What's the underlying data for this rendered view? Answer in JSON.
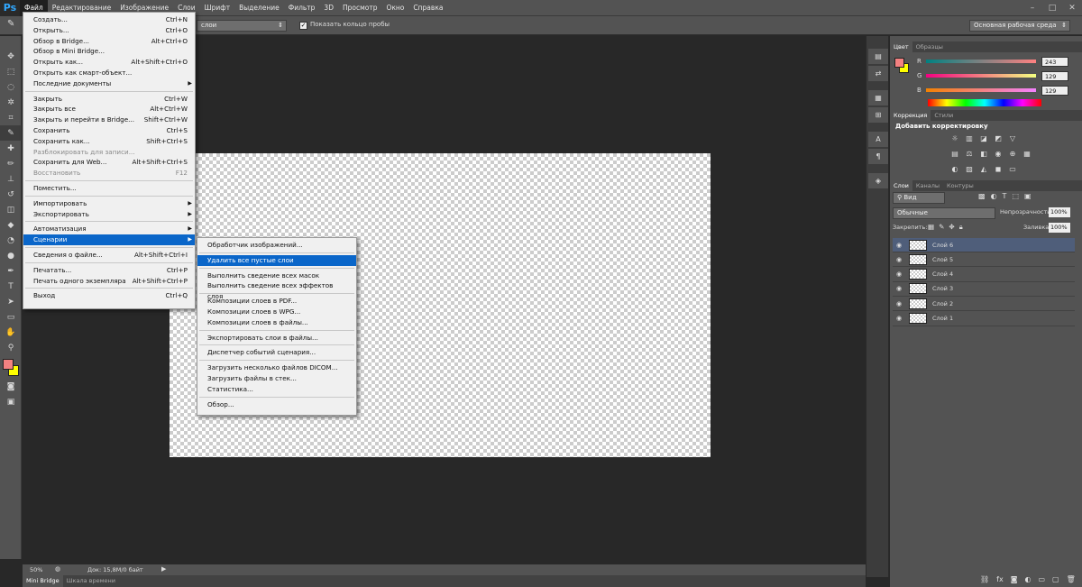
{
  "app": {
    "logo": "Ps"
  },
  "menubar": [
    "Файл",
    "Редактирование",
    "Изображение",
    "Слои",
    "Шрифт",
    "Выделение",
    "Фильтр",
    "3D",
    "Просмотр",
    "Окно",
    "Справка"
  ],
  "options_bar": {
    "mode_value": "слои",
    "sample_ring_label": "Показать кольцо пробы",
    "workspace": "Основная рабочая среда"
  },
  "file_menu": [
    {
      "label": "Создать...",
      "shortcut": "Ctrl+N"
    },
    {
      "label": "Открыть...",
      "shortcut": "Ctrl+O"
    },
    {
      "label": "Обзор в Bridge...",
      "shortcut": "Alt+Ctrl+O"
    },
    {
      "label": "Обзор в Mini Bridge...",
      "shortcut": ""
    },
    {
      "label": "Открыть как...",
      "shortcut": "Alt+Shift+Ctrl+O"
    },
    {
      "label": "Открыть как смарт-объект...",
      "shortcut": ""
    },
    {
      "label": "Последние документы",
      "shortcut": "",
      "submenu": true
    },
    {
      "sep": true
    },
    {
      "label": "Закрыть",
      "shortcut": "Ctrl+W"
    },
    {
      "label": "Закрыть все",
      "shortcut": "Alt+Ctrl+W"
    },
    {
      "label": "Закрыть и перейти в Bridge...",
      "shortcut": "Shift+Ctrl+W"
    },
    {
      "label": "Сохранить",
      "shortcut": "Ctrl+S"
    },
    {
      "label": "Сохранить как...",
      "shortcut": "Shift+Ctrl+S"
    },
    {
      "label": "Разблокировать для записи...",
      "shortcut": "",
      "disabled": true
    },
    {
      "label": "Сохранить для Web...",
      "shortcut": "Alt+Shift+Ctrl+S"
    },
    {
      "label": "Восстановить",
      "shortcut": "F12",
      "disabled": true
    },
    {
      "sep": true
    },
    {
      "label": "Поместить...",
      "shortcut": ""
    },
    {
      "sep": true
    },
    {
      "label": "Импортировать",
      "shortcut": "",
      "submenu": true
    },
    {
      "label": "Экспортировать",
      "shortcut": "",
      "submenu": true
    },
    {
      "sep": true
    },
    {
      "label": "Автоматизация",
      "shortcut": "",
      "submenu": true
    },
    {
      "label": "Сценарии",
      "shortcut": "",
      "submenu": true,
      "selected": true
    },
    {
      "sep": true
    },
    {
      "label": "Сведения о файле...",
      "shortcut": "Alt+Shift+Ctrl+I"
    },
    {
      "sep": true
    },
    {
      "label": "Печатать...",
      "shortcut": "Ctrl+P"
    },
    {
      "label": "Печать одного экземпляра",
      "shortcut": "Alt+Shift+Ctrl+P"
    },
    {
      "sep": true
    },
    {
      "label": "Выход",
      "shortcut": "Ctrl+Q"
    }
  ],
  "scripts_submenu": [
    {
      "label": "Обработчик изображений..."
    },
    {
      "sep": true
    },
    {
      "label": "Удалить все пустые слои",
      "selected": true
    },
    {
      "sep": true
    },
    {
      "label": "Выполнить сведение всех масок"
    },
    {
      "label": "Выполнить сведение всех эффектов слоя"
    },
    {
      "sep": true
    },
    {
      "label": "Композиции слоев в PDF..."
    },
    {
      "label": "Композиции слоев в WPG..."
    },
    {
      "label": "Композиции слоев в файлы..."
    },
    {
      "sep": true
    },
    {
      "label": "Экспортировать слои в файлы..."
    },
    {
      "sep": true
    },
    {
      "label": "Диспетчер событий сценария..."
    },
    {
      "sep": true
    },
    {
      "label": "Загрузить несколько файлов DICOM..."
    },
    {
      "label": "Загрузить файлы в стек..."
    },
    {
      "label": "Статистика..."
    },
    {
      "sep": true
    },
    {
      "label": "Обзор..."
    }
  ],
  "color_panel": {
    "tabs": [
      "Цвет",
      "Образцы"
    ],
    "r_label": "R",
    "g_label": "G",
    "b_label": "B",
    "r": "243",
    "g": "129",
    "b": "129",
    "fg": "#f38181",
    "bg": "#ffff00"
  },
  "adjustments_panel": {
    "tabs": [
      "Коррекция",
      "Стили"
    ],
    "title": "Добавить корректировку"
  },
  "layers_panel": {
    "tabs": [
      "Слои",
      "Каналы",
      "Контуры"
    ],
    "filter_label": "Вид",
    "blend_mode": "Обычные",
    "opacity_label": "Непрозрачность:",
    "opacity": "100%",
    "lock_label": "Закрепить:",
    "fill_label": "Заливка:",
    "fill": "100%",
    "layers": [
      "Слой 6",
      "Слой 5",
      "Слой 4",
      "Слой 3",
      "Слой 2",
      "Слой 1"
    ]
  },
  "status_bar": {
    "zoom": "50%",
    "doc_info": "Док: 15,8M/0 байт"
  },
  "bottom_tabs": [
    "Mini Bridge",
    "Шкала времени"
  ]
}
